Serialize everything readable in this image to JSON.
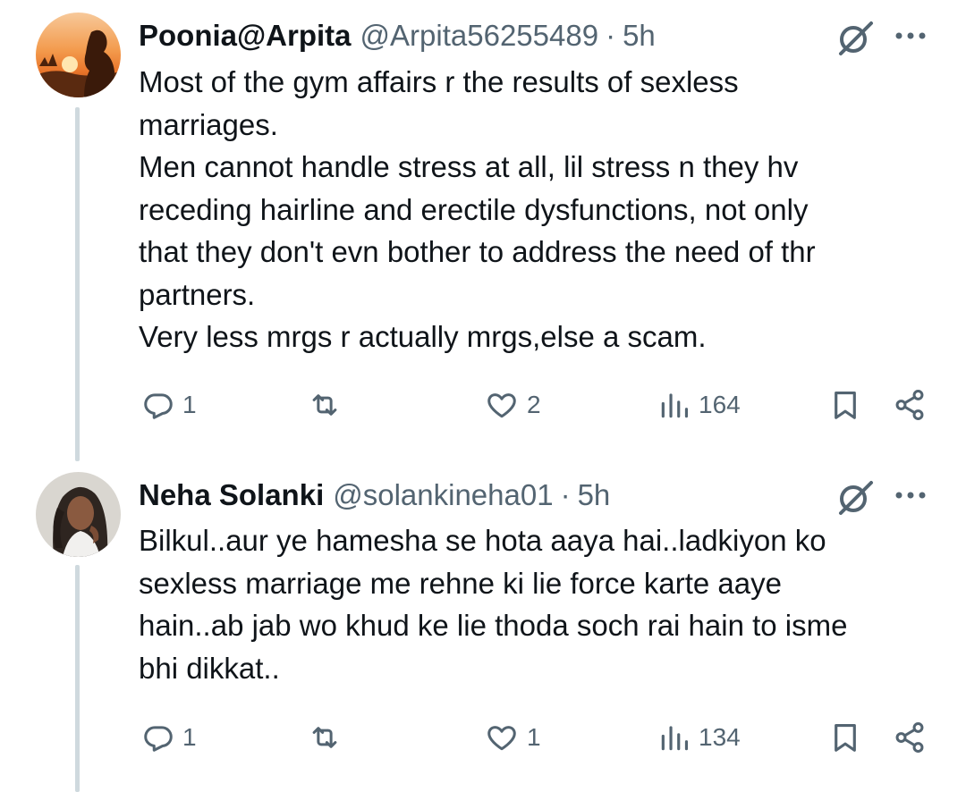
{
  "tweets": [
    {
      "display_name": "Poonia@Arpita",
      "handle": "@Arpita56255489",
      "separator": "·",
      "time": "5h",
      "text": "Most of the gym affairs r the results of sexless\nmarriages.\nMen cannot handle stress at all, lil stress n they hv\nreceding hairline and erectile dysfunctions, not only\nthat they don't evn bother to address the need of thr\npartners.\nVery less mrgs r actually mrgs,else a scam.",
      "replies": "1",
      "likes": "2",
      "views": "164"
    },
    {
      "display_name": "Neha Solanki",
      "handle": "@solankineha01",
      "separator": "·",
      "time": "5h",
      "text": "Bilkul..aur ye hamesha se hota aaya hai..ladkiyon ko\nsexless marriage me rehne ki lie force karte aaye\nhain..ab jab wo khud ke lie thoda soch rai hain to isme\nbhi dikkat..",
      "replies": "1",
      "likes": "1",
      "views": "134"
    }
  ],
  "icons": {
    "reply": "reply-icon",
    "retweet": "retweet-icon",
    "like": "heart-icon",
    "views": "views-icon",
    "bookmark": "bookmark-icon",
    "share": "share-icon",
    "grok": "grok-icon",
    "more": "more-icon"
  },
  "colors": {
    "text": "#0f1419",
    "secondary": "#536471",
    "thread_line": "#cfd9de",
    "background": "#ffffff"
  }
}
